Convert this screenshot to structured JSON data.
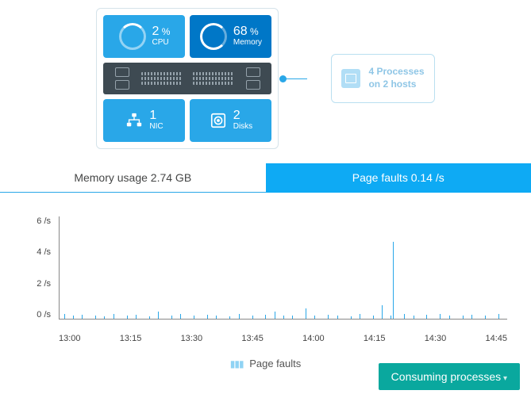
{
  "tiles": {
    "cpu": {
      "value": "2",
      "pct": "%",
      "label": "CPU"
    },
    "memory": {
      "value": "68",
      "pct": "%",
      "label": "Memory"
    },
    "nic": {
      "value": "1",
      "label": "NIC"
    },
    "disks": {
      "value": "2",
      "label": "Disks"
    }
  },
  "side": {
    "line1": "4 Processes",
    "line2": "on 2 hosts"
  },
  "tabs": {
    "memory": "Memory usage 2.74 GB",
    "faults": "Page faults 0.14 /s"
  },
  "chart_data": {
    "type": "bar",
    "title": "Page faults",
    "ylabel": "/s",
    "ylim": [
      0,
      6
    ],
    "y_ticks": [
      "6 /s",
      "4 /s",
      "2 /s",
      "0 /s"
    ],
    "x_ticks": [
      "13:00",
      "13:15",
      "13:30",
      "13:45",
      "14:00",
      "14:15",
      "14:30",
      "14:45"
    ],
    "series": [
      {
        "name": "Page faults",
        "color": "#29a7e8",
        "x_pct": [
          1,
          3,
          5,
          8,
          10,
          12,
          15,
          17,
          20,
          22,
          25,
          27,
          30,
          33,
          35,
          38,
          40,
          43,
          46,
          48,
          50,
          52,
          55,
          57,
          60,
          62,
          65,
          67,
          70,
          72,
          74,
          74.5,
          77,
          79,
          82,
          85,
          87,
          90,
          92,
          95,
          98
        ],
        "values": [
          0.3,
          0.2,
          0.25,
          0.2,
          0.15,
          0.3,
          0.2,
          0.25,
          0.15,
          0.4,
          0.2,
          0.3,
          0.2,
          0.25,
          0.2,
          0.15,
          0.3,
          0.2,
          0.25,
          0.4,
          0.2,
          0.2,
          0.6,
          0.2,
          0.25,
          0.2,
          0.15,
          0.3,
          0.2,
          0.8,
          0.2,
          4.5,
          0.3,
          0.2,
          0.25,
          0.3,
          0.2,
          0.2,
          0.25,
          0.2,
          0.3
        ]
      }
    ]
  },
  "cta": "Consuming processes"
}
